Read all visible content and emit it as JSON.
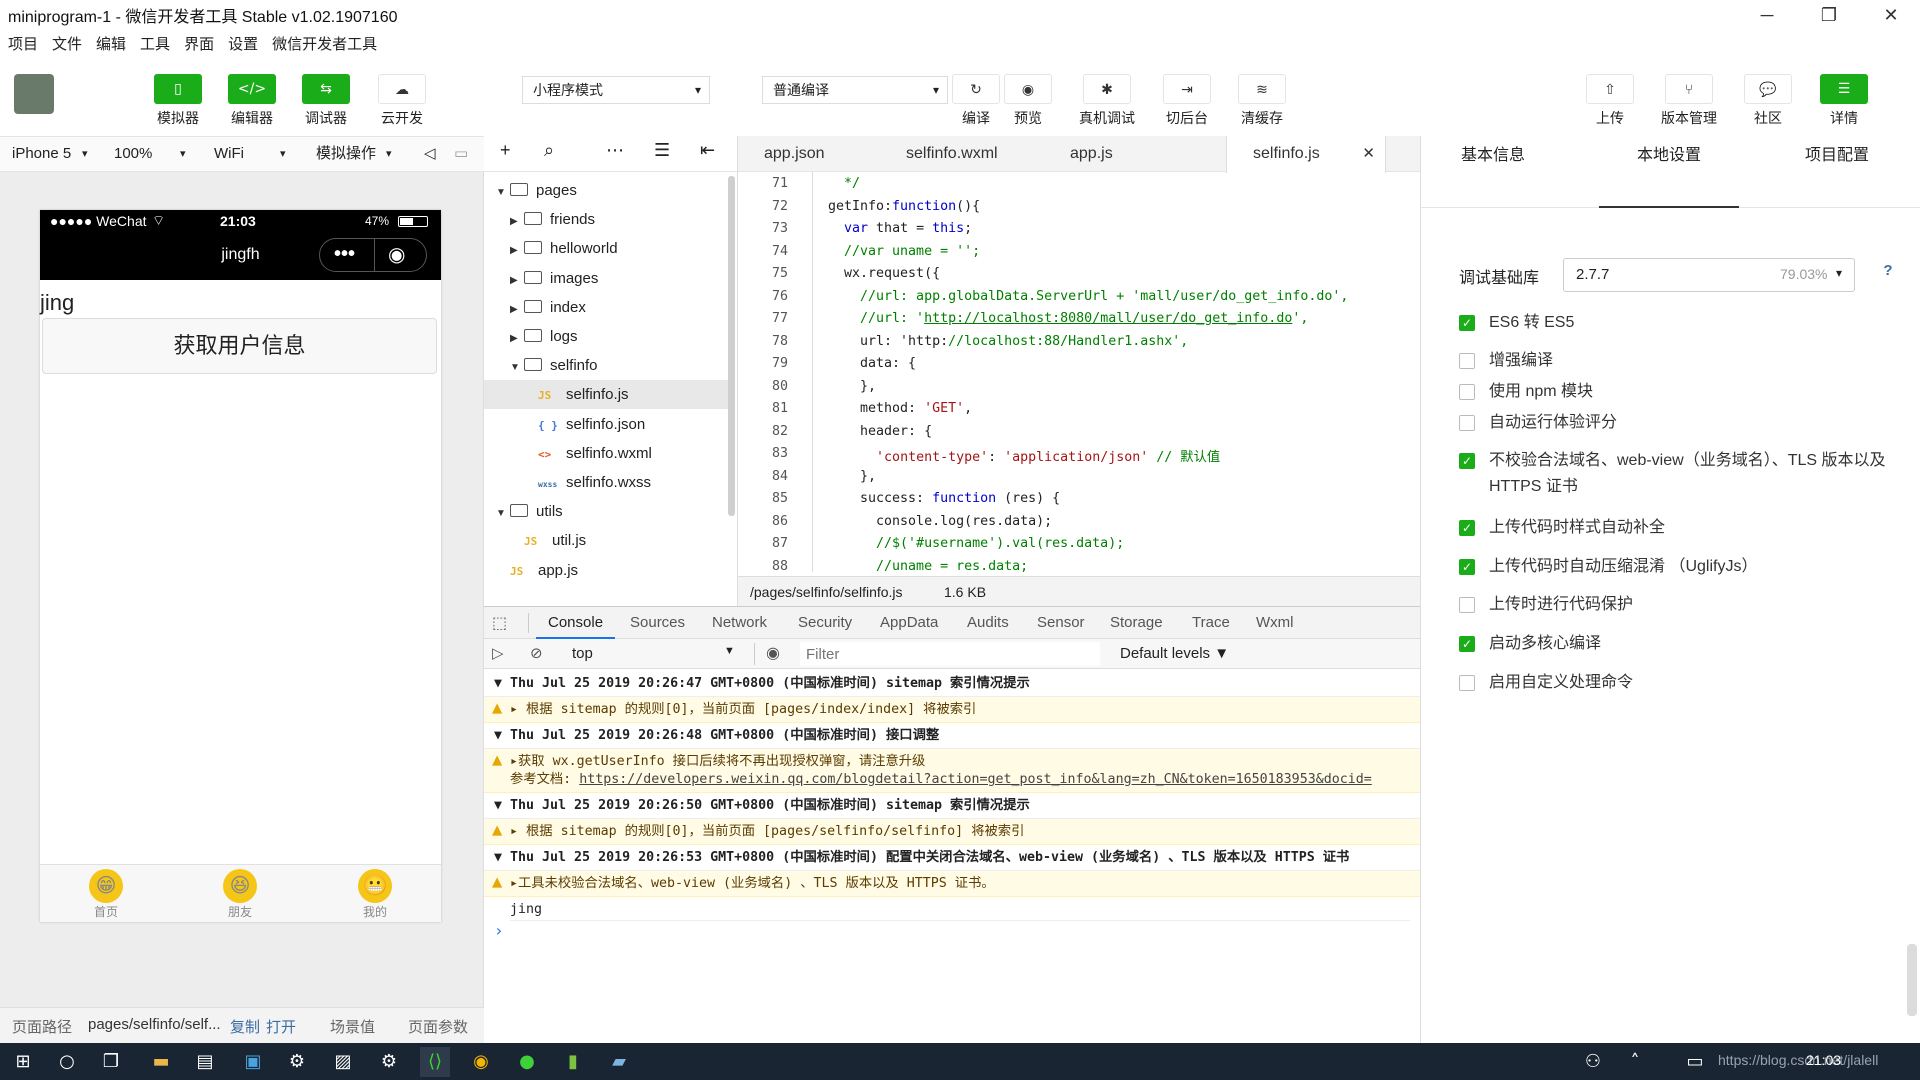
{
  "window": {
    "title": "miniprogram-1 - 微信开发者工具 Stable v1.02.1907160",
    "min": "─",
    "max": "❐",
    "close": "✕"
  },
  "menu": [
    "项目",
    "文件",
    "编辑",
    "工具",
    "界面",
    "设置",
    "微信开发者工具"
  ],
  "toolbar": {
    "left": [
      {
        "label": "模拟器",
        "icon": "▯"
      },
      {
        "label": "编辑器",
        "icon": "</>"
      },
      {
        "label": "调试器",
        "icon": "⇆"
      },
      {
        "label": "云开发",
        "icon": "☁"
      }
    ],
    "mode_select": "小程序模式",
    "compile_select": "普通编译",
    "center": [
      {
        "label": "编译",
        "icon": "↻"
      },
      {
        "label": "预览",
        "icon": "◉"
      },
      {
        "label": "真机调试",
        "icon": "✱"
      },
      {
        "label": "切后台",
        "icon": "⇥"
      },
      {
        "label": "清缓存",
        "icon": "≋"
      }
    ],
    "right": [
      {
        "label": "上传",
        "icon": "⇧"
      },
      {
        "label": "版本管理",
        "icon": "⑂"
      },
      {
        "label": "社区",
        "icon": "💬"
      },
      {
        "label": "详情",
        "icon": "☰"
      }
    ]
  },
  "simbar": {
    "device": "iPhone 5",
    "zoom": "100%",
    "network": "WiFi",
    "ops": "模拟操作"
  },
  "phone": {
    "carrier": "●●●●● WeChat",
    "wifi": "⌔",
    "time": "21:03",
    "battery": "47%",
    "nav_title": "jingfh",
    "capsule_dots": "•••",
    "capsule_target": "◉",
    "text": "jing",
    "button": "获取用户信息",
    "tabs": [
      {
        "label": "首页",
        "emoji": "😁"
      },
      {
        "label": "朋友",
        "emoji": "😆"
      },
      {
        "label": "我的",
        "emoji": "😬"
      }
    ]
  },
  "simfoot": {
    "path_label": "页面路径",
    "path": "pages/selfinfo/self...",
    "copy": "复制",
    "open": "打开",
    "scene": "场景值",
    "params": "页面参数"
  },
  "filetree": {
    "tools": [
      "+",
      "⌕",
      "⋯",
      "☰",
      "⇤"
    ],
    "items": [
      {
        "label": "pages",
        "type": "folder",
        "open": true,
        "depth": 0
      },
      {
        "label": "friends",
        "type": "folder",
        "open": false,
        "depth": 1
      },
      {
        "label": "helloworld",
        "type": "folder",
        "open": false,
        "depth": 1
      },
      {
        "label": "images",
        "type": "folder",
        "open": false,
        "depth": 1
      },
      {
        "label": "index",
        "type": "folder",
        "open": false,
        "depth": 1
      },
      {
        "label": "logs",
        "type": "folder",
        "open": false,
        "depth": 1
      },
      {
        "label": "selfinfo",
        "type": "folder",
        "open": true,
        "depth": 1
      },
      {
        "label": "selfinfo.js",
        "type": "JS",
        "depth": 2,
        "selected": true
      },
      {
        "label": "selfinfo.json",
        "type": "{ }",
        "depth": 2
      },
      {
        "label": "selfinfo.wxml",
        "type": "<>",
        "depth": 2
      },
      {
        "label": "selfinfo.wxss",
        "type": "wxss",
        "depth": 2
      },
      {
        "label": "utils",
        "type": "folder",
        "open": true,
        "depth": 0
      },
      {
        "label": "util.js",
        "type": "JS",
        "depth": 1
      },
      {
        "label": "app.js",
        "type": "JS",
        "depth": 0
      }
    ]
  },
  "editor": {
    "tabs": [
      "app.json",
      "selfinfo.wxml",
      "app.js",
      "selfinfo.js"
    ],
    "active_tab": "selfinfo.js",
    "close": "✕",
    "lines": [
      {
        "n": "71",
        "t": "  */"
      },
      {
        "n": "72",
        "t": "getInfo:function(){"
      },
      {
        "n": "73",
        "t": "  var that = this;"
      },
      {
        "n": "74",
        "t": "  //var uname = '';"
      },
      {
        "n": "75",
        "t": "  wx.request({"
      },
      {
        "n": "76",
        "t": "    //url: app.globalData.ServerUrl + 'mall/user/do_get_info.do',"
      },
      {
        "n": "77",
        "t": "    //url: 'http://localhost:8080/mall/user/do_get_info.do',"
      },
      {
        "n": "78",
        "t": "    url: 'http://localhost:88/Handler1.ashx',"
      },
      {
        "n": "79",
        "t": "    data: {"
      },
      {
        "n": "80",
        "t": "    },"
      },
      {
        "n": "81",
        "t": "    method: 'GET',"
      },
      {
        "n": "82",
        "t": "    header: {"
      },
      {
        "n": "83",
        "t": "      'content-type': 'application/json' // 默认值"
      },
      {
        "n": "84",
        "t": "    },"
      },
      {
        "n": "85",
        "t": "    success: function (res) {"
      },
      {
        "n": "86",
        "t": "      console.log(res.data);"
      },
      {
        "n": "87",
        "t": "      //$('#username').val(res.data);"
      },
      {
        "n": "88",
        "t": "      //uname = res.data;"
      }
    ],
    "status_path": "/pages/selfinfo/selfinfo.js",
    "status_size": "1.6 KB"
  },
  "devtools": {
    "tabs": [
      "Console",
      "Sources",
      "Network",
      "Security",
      "AppData",
      "Audits",
      "Sensor",
      "Storage",
      "Trace",
      "Wxml"
    ],
    "context": "top",
    "filter_placeholder": "Filter",
    "levels": "Default levels ▼",
    "groups": [
      {
        "head": "▼ Thu Jul 25 2019 20:26:47 GMT+0800 (中国标准时间) sitemap 索引情况提示",
        "warn": [
          "▸ 根据 sitemap 的规则[0]，当前页面 [pages/index/index] 将被索引"
        ]
      },
      {
        "head": "▼ Thu Jul 25 2019 20:26:48 GMT+0800 (中国标准时间) 接口调整",
        "warn": [
          "▸获取 wx.getUserInfo 接口后续将不再出现授权弹窗，请注意升级",
          "参考文档: https://developers.weixin.qq.com/blogdetail?action=get_post_info&lang=zh_CN&token=1650183953&docid="
        ]
      },
      {
        "head": "▼ Thu Jul 25 2019 20:26:50 GMT+0800 (中国标准时间) sitemap 索引情况提示",
        "warn": [
          "▸ 根据 sitemap 的规则[0]，当前页面 [pages/selfinfo/selfinfo] 将被索引"
        ]
      },
      {
        "head": "▼ Thu Jul 25 2019 20:26:53 GMT+0800 (中国标准时间) 配置中关闭合法域名、web-view (业务域名) 、TLS 版本以及 HTTPS 证书",
        "warn": [
          "▸工具未校验合法域名、web-view (业务域名) 、TLS 版本以及 HTTPS 证书。"
        ]
      }
    ],
    "log": "jing",
    "prompt": "›"
  },
  "rightpanel": {
    "tabs": [
      "基本信息",
      "本地设置",
      "项目配置"
    ],
    "active": "本地设置",
    "lib_label": "调试基础库",
    "lib_version": "2.7.7",
    "lib_pct": "79.03%",
    "help": "?",
    "options": [
      {
        "label": "ES6 转 ES5",
        "checked": true
      },
      {
        "label": "增强编译",
        "checked": false
      },
      {
        "label": "使用 npm 模块",
        "checked": false
      },
      {
        "label": "自动运行体验评分",
        "checked": false
      },
      {
        "label": "不校验合法域名、web-view（业务域名）、TLS 版本以及 HTTPS 证书",
        "checked": true
      },
      {
        "label": "上传代码时样式自动补全",
        "checked": true
      },
      {
        "label": "上传代码时自动压缩混淆 （UglifyJs）",
        "checked": true
      },
      {
        "label": "上传时进行代码保护",
        "checked": false
      },
      {
        "label": "启动多核心编译",
        "checked": true
      },
      {
        "label": "启用自定义处理命令",
        "checked": false
      }
    ]
  },
  "taskbar": {
    "tray_text": "https://blog.csdn.net/jlalell",
    "time": "21:03"
  },
  "colors": {
    "accent": "#1aad19",
    "taskbar": "#1a2533"
  }
}
